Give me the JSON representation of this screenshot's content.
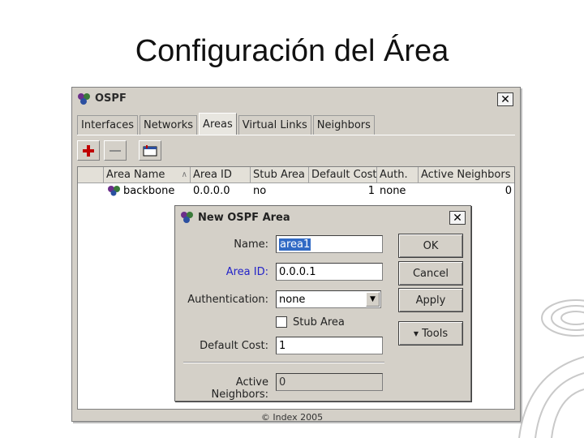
{
  "slide": {
    "title": "Configuración del Área",
    "footer": "© Index 2005"
  },
  "window": {
    "title": "OSPF",
    "close_icon": "close-icon",
    "tabs": [
      {
        "label": "Interfaces"
      },
      {
        "label": "Networks"
      },
      {
        "label": "Areas",
        "active": true
      },
      {
        "label": "Virtual Links"
      },
      {
        "label": "Neighbors"
      }
    ],
    "toolbar": [
      "add-icon",
      "remove-icon",
      "filter-icon"
    ],
    "table": {
      "headers": [
        "Area Name",
        "Area ID",
        "Stub Area",
        "Default Cost",
        "Auth.",
        "Active Neighbors"
      ],
      "rows": [
        {
          "name": "backbone",
          "area_id": "0.0.0.0",
          "stub": "no",
          "cost": "1",
          "auth": "none",
          "neighbors": "0"
        }
      ]
    }
  },
  "dialog": {
    "title": "New OSPF Area",
    "name_label": "Name:",
    "name_value": "area1",
    "area_id_label": "Area ID:",
    "area_id_value": "0.0.0.1",
    "auth_label": "Authentication:",
    "auth_value": "none",
    "stub_label": "Stub Area",
    "stub_checked": false,
    "cost_label": "Default Cost:",
    "cost_value": "1",
    "neighbors_label": "Active Neighbors:",
    "neighbors_value": "0",
    "buttons": {
      "ok": "OK",
      "cancel": "Cancel",
      "apply": "Apply",
      "tools": "Tools"
    }
  },
  "colors": {
    "accent_blue": "#2323c8",
    "selection": "#316ac5",
    "add_red": "#c00000"
  }
}
